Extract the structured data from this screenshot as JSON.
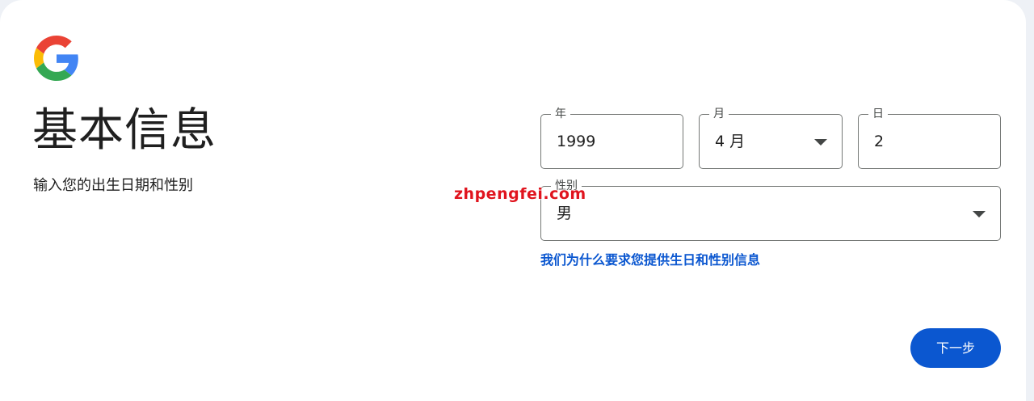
{
  "logo": {
    "icon": "google-g-icon",
    "colors": [
      "#4285F4",
      "#EA4335",
      "#FBBC05",
      "#34A853"
    ]
  },
  "header": {
    "title": "基本信息",
    "subtitle": "输入您的出生日期和性别"
  },
  "form": {
    "year": {
      "label": "年",
      "value": "1999"
    },
    "month": {
      "label": "月",
      "value": "4 月",
      "icon": "dropdown-arrow-icon"
    },
    "day": {
      "label": "日",
      "value": "2"
    },
    "gender": {
      "label": "性别",
      "value": "男",
      "icon": "dropdown-arrow-icon"
    },
    "why_link": "我们为什么要求您提供生日和性别信息"
  },
  "watermark": "zhpengfei.com",
  "actions": {
    "next_label": "下一步"
  },
  "theme": {
    "accent": "#0b57d0",
    "border": "#747775",
    "watermark_color": "#e0141e"
  }
}
